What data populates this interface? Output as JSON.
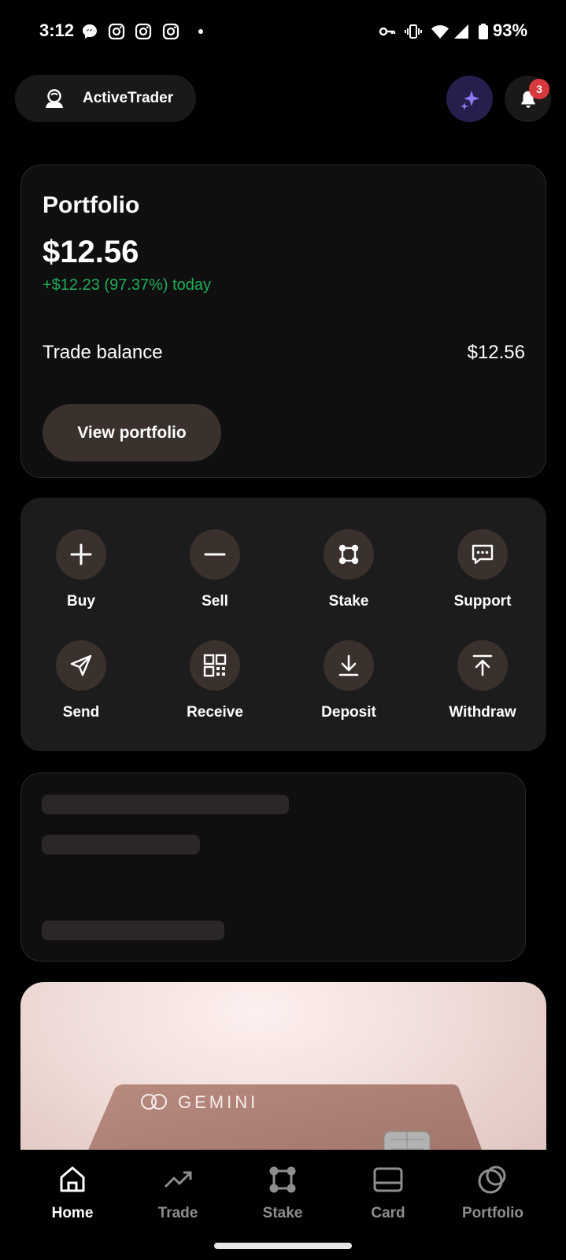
{
  "status_bar": {
    "time": "3:12",
    "battery_text": "93%",
    "icons": [
      "messenger-icon",
      "instagram-icon",
      "instagram-icon",
      "instagram-icon",
      "dot-icon",
      "key-icon",
      "vibrate-icon",
      "wifi-icon",
      "signal-icon",
      "battery-icon"
    ]
  },
  "header": {
    "username": "ActiveTrader",
    "notifications_count": "3"
  },
  "portfolio": {
    "title": "Portfolio",
    "value": "$12.56",
    "change": "+$12.23 (97.37%) today",
    "balance_label": "Trade balance",
    "balance_value": "$12.56",
    "view_button": "View portfolio"
  },
  "actions": [
    {
      "label": "Buy",
      "icon": "plus-icon"
    },
    {
      "label": "Sell",
      "icon": "minus-icon"
    },
    {
      "label": "Stake",
      "icon": "stake-icon"
    },
    {
      "label": "Support",
      "icon": "chat-icon"
    },
    {
      "label": "Send",
      "icon": "send-icon"
    },
    {
      "label": "Receive",
      "icon": "qr-icon"
    },
    {
      "label": "Deposit",
      "icon": "download-icon"
    },
    {
      "label": "Withdraw",
      "icon": "upload-icon"
    }
  ],
  "promo": {
    "card_brand": "GEMINI"
  },
  "bottom_nav": [
    {
      "label": "Home",
      "icon": "home-icon",
      "active": true
    },
    {
      "label": "Trade",
      "icon": "trend-icon",
      "active": false
    },
    {
      "label": "Stake",
      "icon": "stake-icon",
      "active": false
    },
    {
      "label": "Card",
      "icon": "card-icon",
      "active": false
    },
    {
      "label": "Portfolio",
      "icon": "portfolio-icon",
      "active": false
    }
  ],
  "colors": {
    "background": "#000000",
    "positive": "#1fae58",
    "button_fill": "#3a302c",
    "badge": "#d8393e",
    "ai_button": "#241f4d",
    "inactive_nav": "#8e8e8e"
  }
}
